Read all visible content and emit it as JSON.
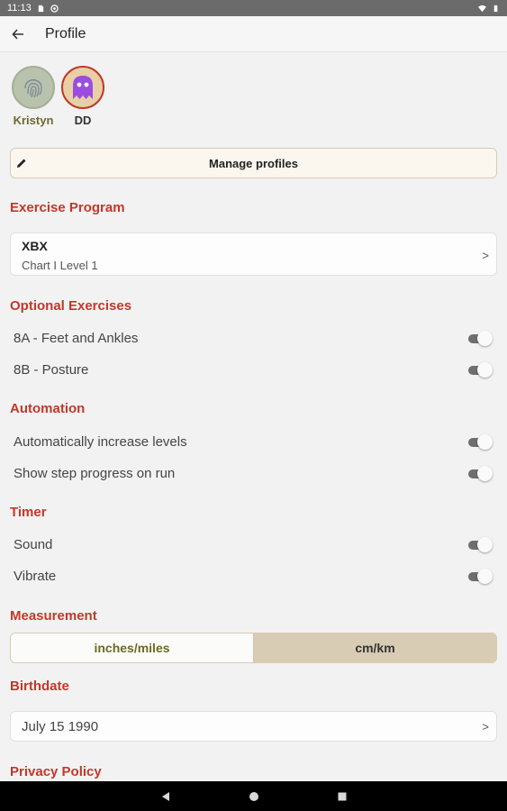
{
  "status_bar": {
    "time": "11:13"
  },
  "app_bar": {
    "title": "Profile"
  },
  "profiles": [
    {
      "name": "Kristyn",
      "avatar": "fingerprint-icon"
    },
    {
      "name": "DD",
      "avatar": "ghost-icon"
    }
  ],
  "manage_profiles": {
    "label": "Manage profiles"
  },
  "exercise_program": {
    "heading": "Exercise Program",
    "title": "XBX",
    "subtitle": "Chart I Level 1",
    "chevron": ">"
  },
  "optional_exercises": {
    "heading": "Optional Exercises",
    "items": [
      {
        "label": "8A - Feet and Ankles",
        "enabled": true
      },
      {
        "label": "8B - Posture",
        "enabled": true
      }
    ]
  },
  "automation": {
    "heading": "Automation",
    "items": [
      {
        "label": "Automatically increase levels",
        "enabled": true
      },
      {
        "label": "Show step progress on run",
        "enabled": true
      }
    ]
  },
  "timer": {
    "heading": "Timer",
    "items": [
      {
        "label": "Sound",
        "enabled": true
      },
      {
        "label": "Vibrate",
        "enabled": true
      }
    ]
  },
  "measurement": {
    "heading": "Measurement",
    "options": [
      "inches/miles",
      "cm/km"
    ],
    "selected": "cm/km"
  },
  "birthdate": {
    "heading": "Birthdate",
    "value": "July 15 1990",
    "chevron": ">"
  },
  "privacy": {
    "heading": "Privacy Policy"
  },
  "colors": {
    "accent": "#c0392b",
    "selected_segment": "#d9ccb5",
    "border": "#d9cbb2"
  }
}
